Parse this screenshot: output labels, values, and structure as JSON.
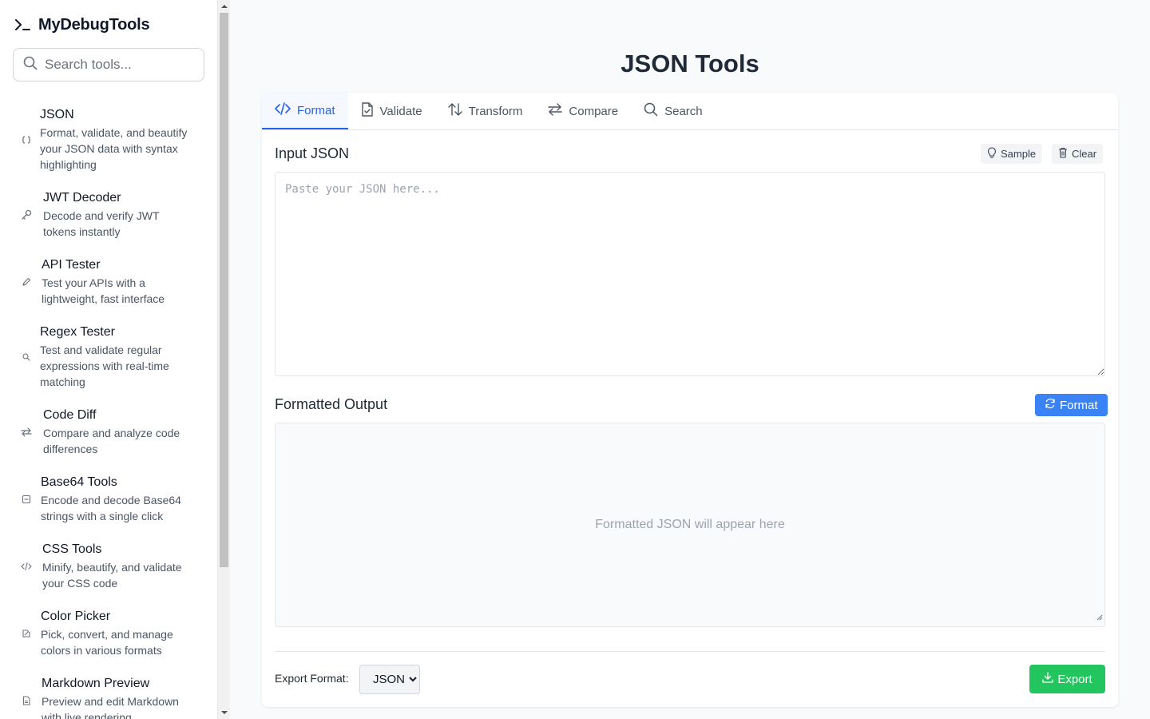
{
  "sidebar": {
    "brand": "MyDebugTools",
    "search_placeholder": "Search tools...",
    "tools": [
      {
        "title": "JSON",
        "desc_lines": [
          "Format, validate, and beautify",
          "your JSON data with syntax",
          "highlighting"
        ],
        "icon": "braces-icon"
      },
      {
        "title": "JWT Decoder",
        "desc_lines": [
          "Decode and verify JWT",
          "tokens instantly"
        ],
        "icon": "key-icon"
      },
      {
        "title": "API Tester",
        "desc_lines": [
          "Test your APIs with a",
          "lightweight, fast interface"
        ],
        "icon": "pen-icon"
      },
      {
        "title": "Regex Tester",
        "desc_lines": [
          "Test and validate regular",
          "expressions with real-time",
          "matching"
        ],
        "icon": "search-icon"
      },
      {
        "title": "Code Diff",
        "desc_lines": [
          "Compare and analyze code",
          "differences"
        ],
        "icon": "swap-icon"
      },
      {
        "title": "Base64 Tools",
        "desc_lines": [
          "Encode and decode Base64",
          "strings with a single click"
        ],
        "icon": "image-icon"
      },
      {
        "title": "CSS Tools",
        "desc_lines": [
          "Minify, beautify, and validate",
          "your CSS code"
        ],
        "icon": "code-icon"
      },
      {
        "title": "Color Picker",
        "desc_lines": [
          "Pick, convert, and manage",
          "colors in various formats"
        ],
        "icon": "palette-icon"
      },
      {
        "title": "Markdown Preview",
        "desc_lines": [
          "Preview and edit Markdown",
          "with live rendering"
        ],
        "icon": "file-icon"
      }
    ]
  },
  "main": {
    "title": "JSON Tools",
    "tabs": [
      {
        "label": "Format",
        "icon": "code-icon",
        "active": true
      },
      {
        "label": "Validate",
        "icon": "file-check-icon",
        "active": false
      },
      {
        "label": "Transform",
        "icon": "arrows-updown-icon",
        "active": false
      },
      {
        "label": "Compare",
        "icon": "swap-icon",
        "active": false
      },
      {
        "label": "Search",
        "icon": "search-icon",
        "active": false
      }
    ],
    "input": {
      "label": "Input JSON",
      "sample_label": "Sample",
      "clear_label": "Clear",
      "placeholder": "Paste your JSON here...",
      "value": ""
    },
    "output": {
      "label": "Formatted Output",
      "format_label": "Format",
      "placeholder": "Formatted JSON will appear here"
    },
    "export": {
      "label": "Export Format:",
      "selected": "JSON",
      "button_label": "Export"
    }
  },
  "colors": {
    "accent": "#2563eb",
    "primary_button": "#3b82f6",
    "export_button": "#22c55e"
  }
}
